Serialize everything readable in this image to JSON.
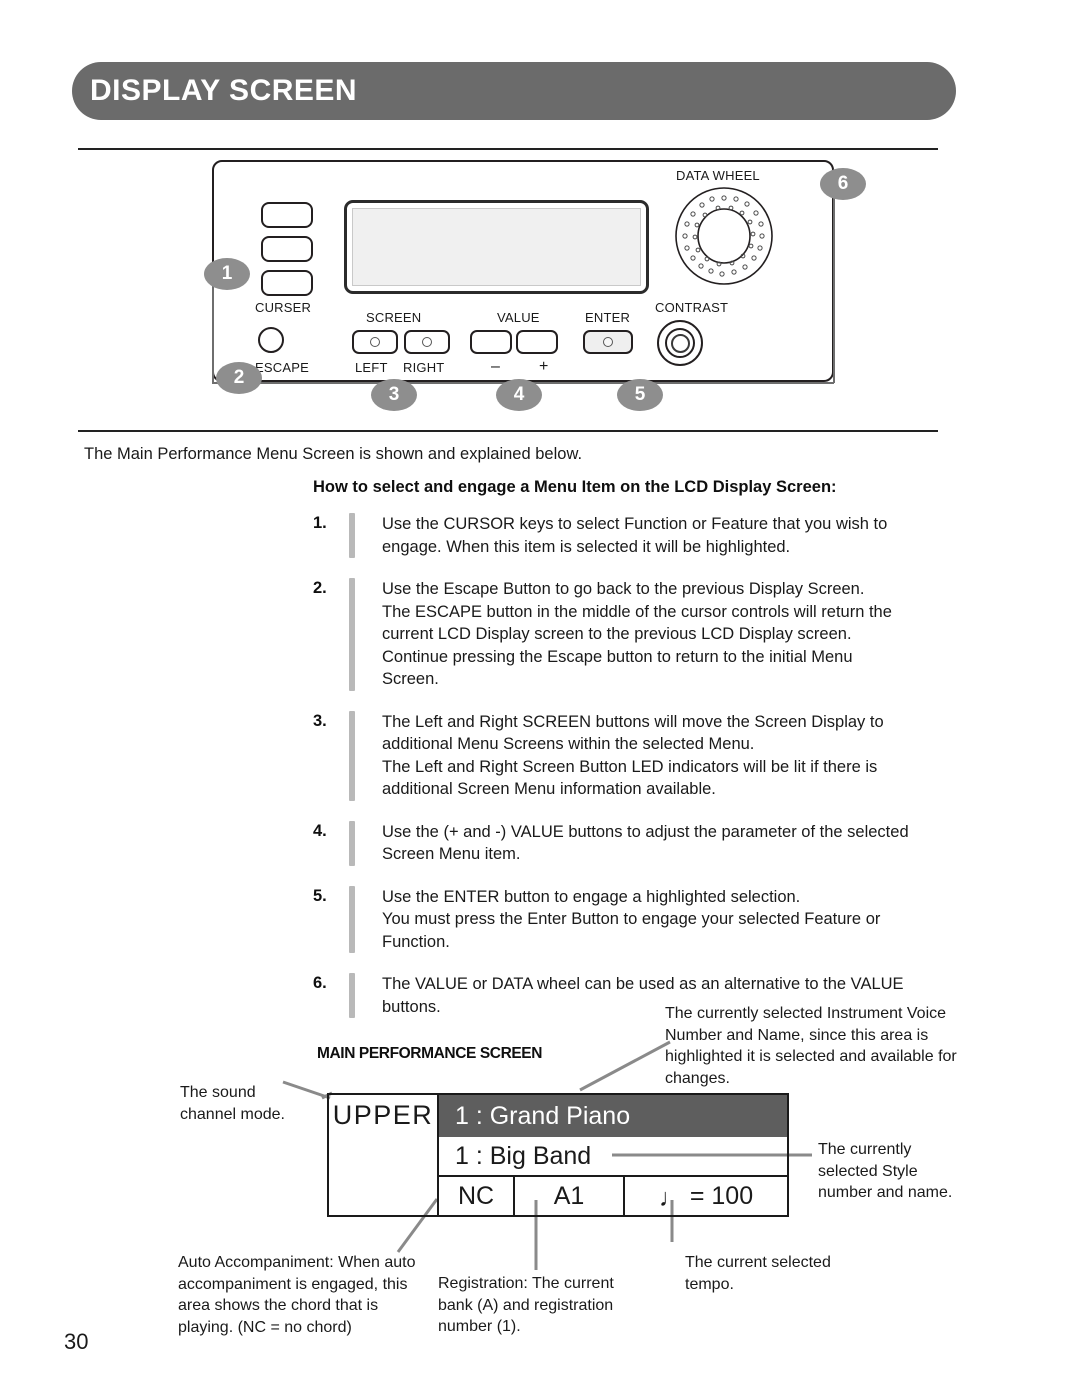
{
  "header": {
    "title": "DISPLAY SCREEN"
  },
  "panel": {
    "labels": {
      "curser": "CURSER",
      "escape": "ESCAPE",
      "screen": "SCREEN",
      "left": "LEFT",
      "right": "RIGHT",
      "value": "VALUE",
      "minus": "–",
      "plus": "+",
      "enter": "ENTER",
      "contrast": "CONTRAST",
      "data_wheel": "DATA WHEEL"
    },
    "callouts": [
      "1",
      "2",
      "3",
      "4",
      "5",
      "6"
    ]
  },
  "body": {
    "intro": "The Main Performance Menu Screen is shown and explained below.",
    "subhead": "How to select and engage a Menu Item on the LCD Display Screen:",
    "steps": [
      {
        "num": "1.",
        "lines": [
          "Use the CURSOR keys to select Function or Feature that you wish to",
          "engage.  When this item is selected it will be highlighted."
        ]
      },
      {
        "num": "2.",
        "lines": [
          "Use the Escape Button to go back to the previous Display Screen.",
          "The ESCAPE button in the middle of the cursor controls will return the",
          "current LCD Display screen to the previous LCD Display screen.",
          "Continue pressing the Escape button to return to the initial Menu",
          "Screen."
        ]
      },
      {
        "num": "3.",
        "lines": [
          "The Left and Right SCREEN buttons will move the Screen Display to",
          "additional Menu Screens within the selected Menu.",
          "The Left and Right Screen Button LED indicators will be lit if there is",
          "additional Screen Menu information available."
        ]
      },
      {
        "num": "4.",
        "lines": [
          "Use the (+ and -) VALUE buttons to adjust the parameter of the selected",
          "Screen Menu item."
        ]
      },
      {
        "num": "5.",
        "lines": [
          "Use the ENTER button to engage a highlighted selection.",
          "You must press the Enter Button to engage your selected Feature or",
          "Function."
        ]
      },
      {
        "num": "6.",
        "lines": [
          "The VALUE or DATA wheel can be used as an alternative to the VALUE",
          "buttons."
        ]
      }
    ]
  },
  "main_screen": {
    "title": "MAIN PERFORMANCE SCREEN",
    "lcd": {
      "channel_mode": "UPPER",
      "voice": "1  :  Grand Piano",
      "style": "1  :  Big Band",
      "chord": "NC",
      "registration": "A1",
      "tempo_note": "♩",
      "tempo": "= 100"
    },
    "annotations": {
      "sound_channel": "The sound channel mode.",
      "voice": "The currently selected Instrument Voice Number and Name, since this area is highlighted it is selected and available for changes.",
      "style": "The currently selected Style number and name.",
      "auto_accomp": "Auto Accompaniment: When auto accompaniment is engaged, this area shows the chord that is playing. (NC = no chord)",
      "registration": "Registration: The current bank (A) and registration number (1).",
      "tempo": "The current selected tempo."
    }
  },
  "footer": {
    "page_number": "30"
  },
  "colors": {
    "header_bar": "#6b6b6b",
    "callout_bubble": "#8e8e8e",
    "highlight_row": "#5e5e5e",
    "step_bar": "#b9b9b9"
  }
}
